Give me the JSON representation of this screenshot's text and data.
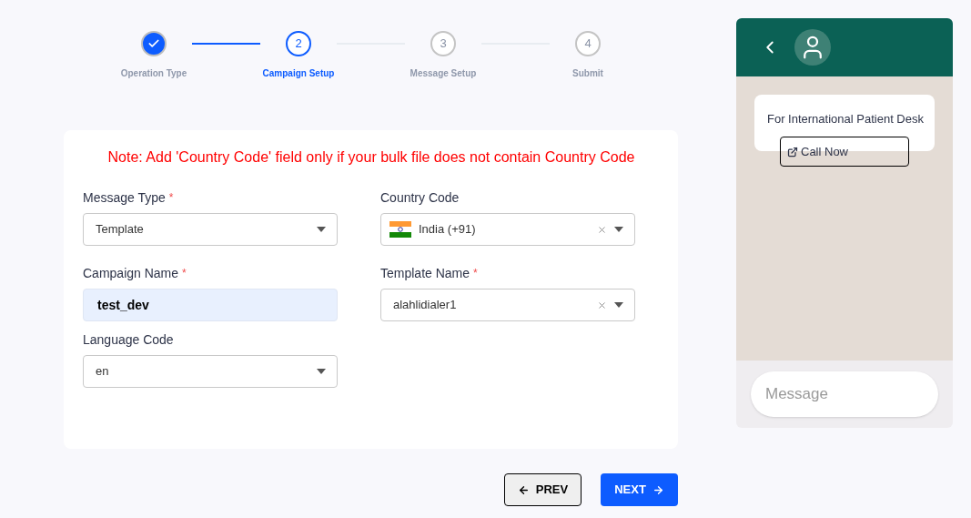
{
  "steps": [
    {
      "label": "Operation Type",
      "completed": true,
      "selected": false
    },
    {
      "number": "2",
      "label": "Campaign Setup",
      "completed": false,
      "selected": true
    },
    {
      "number": "3",
      "label": "Message Setup",
      "completed": false,
      "selected": false
    },
    {
      "number": "4",
      "label": "Submit",
      "completed": false,
      "selected": false
    }
  ],
  "note": "Note: Add 'Country Code' field only if your bulk file does not contain Country Code",
  "fields": [
    {
      "label": "Message Type",
      "required_mark": "*",
      "kind": "select",
      "value": "Template",
      "clearable": false,
      "flag": false
    },
    {
      "label": "Country Code",
      "kind": "select",
      "value": "India (+91)",
      "clearable": true,
      "flag": true
    },
    {
      "label": "Campaign Name",
      "required_mark": "*",
      "kind": "input",
      "value": "test_dev"
    },
    {
      "label": "Template Name",
      "required_mark": "*",
      "kind": "select",
      "value": "alahlidialer1",
      "clearable": true,
      "flag": false
    },
    {
      "label": "Language Code",
      "kind": "select",
      "value": "en",
      "clearable": false,
      "flag": false
    }
  ],
  "buttons": [
    {
      "label": "PREV",
      "kind": "prev"
    },
    {
      "label": "NEXT",
      "kind": "next"
    }
  ],
  "preview": {
    "message": "For International Patient Desk",
    "action": "Call Now",
    "composer_placeholder": "Message"
  }
}
